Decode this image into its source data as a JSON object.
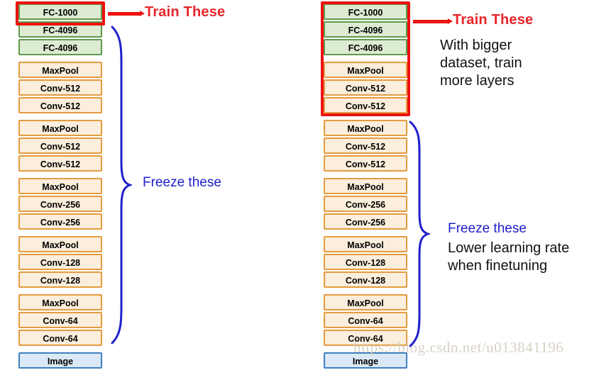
{
  "background": "#ffffff",
  "colors": {
    "fc_border": "#5f9b4b",
    "fc_fill": "#ddebd3",
    "conv_border": "#e49b3f",
    "conv_fill": "#fbeedc",
    "image_border": "#3f7fbf",
    "image_fill": "#dbe9f6",
    "highlight_red": "#ee1111",
    "train_text_red": "#e8252a",
    "freeze_text_blue": "#2020cc",
    "brace_blue": "#2020cc",
    "note_text": "#111111",
    "watermark": "#d7d2c4"
  },
  "left_column": {
    "name": "vgg-network-stack-left",
    "groups": [
      {
        "type": "fc",
        "blocks": [
          "FC-1000",
          "FC-4096",
          "FC-4096"
        ]
      },
      {
        "type": "conv",
        "blocks": [
          "MaxPool",
          "Conv-512",
          "Conv-512"
        ]
      },
      {
        "type": "conv",
        "blocks": [
          "MaxPool",
          "Conv-512",
          "Conv-512"
        ]
      },
      {
        "type": "conv",
        "blocks": [
          "MaxPool",
          "Conv-256",
          "Conv-256"
        ]
      },
      {
        "type": "conv",
        "blocks": [
          "MaxPool",
          "Conv-128",
          "Conv-128"
        ]
      },
      {
        "type": "conv",
        "blocks": [
          "MaxPool",
          "Conv-64",
          "Conv-64"
        ]
      },
      {
        "type": "image",
        "blocks": [
          "Image"
        ]
      }
    ],
    "train_label": "Train These",
    "freeze_label": "Freeze these"
  },
  "right_column": {
    "name": "vgg-network-stack-right",
    "groups": [
      {
        "type": "fc",
        "blocks": [
          "FC-1000",
          "FC-4096",
          "FC-4096"
        ]
      },
      {
        "type": "conv",
        "blocks": [
          "MaxPool",
          "Conv-512",
          "Conv-512"
        ]
      },
      {
        "type": "conv",
        "blocks": [
          "MaxPool",
          "Conv-512",
          "Conv-512"
        ]
      },
      {
        "type": "conv",
        "blocks": [
          "MaxPool",
          "Conv-256",
          "Conv-256"
        ]
      },
      {
        "type": "conv",
        "blocks": [
          "MaxPool",
          "Conv-128",
          "Conv-128"
        ]
      },
      {
        "type": "conv",
        "blocks": [
          "MaxPool",
          "Conv-64",
          "Conv-64"
        ]
      },
      {
        "type": "image",
        "blocks": [
          "Image"
        ]
      }
    ],
    "train_label": "Train These",
    "train_note": "With bigger\ndataset, train\nmore layers",
    "freeze_label": "Freeze these",
    "freeze_note": "Lower learning rate\nwhen finetuning"
  },
  "watermark": "https://blog.csdn.net/u013841196"
}
